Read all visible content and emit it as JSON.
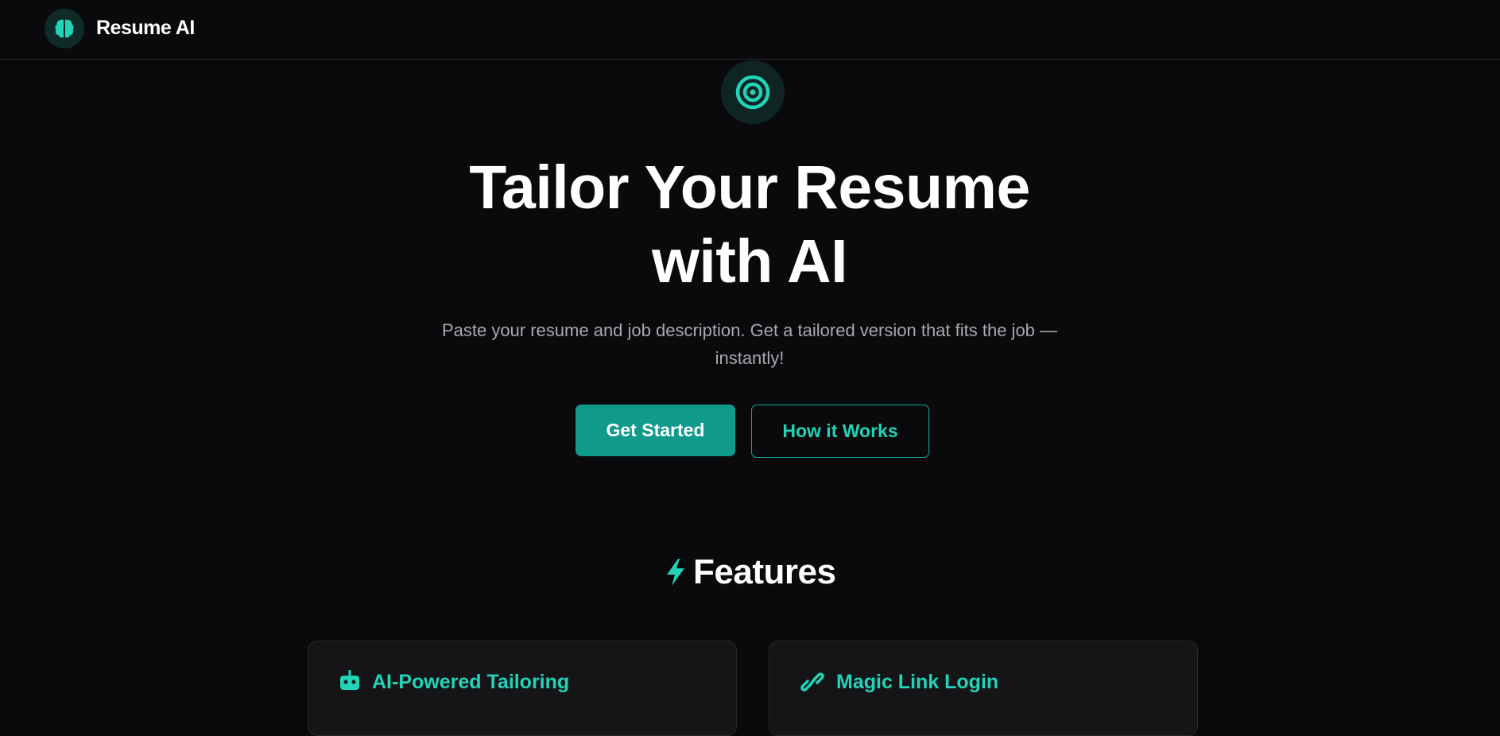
{
  "navbar": {
    "logo_icon": "brain-icon",
    "app_name": "Resume AI"
  },
  "hero": {
    "icon": "target-icon",
    "title_line1": "Tailor Your Resume",
    "title_line2": "with AI",
    "subtitle": "Paste your resume and job description. Get a tailored version that fits the job — instantly!",
    "primary_button_label": "Get Started",
    "secondary_button_label": "How it Works"
  },
  "features": {
    "icon": "lightning-icon",
    "title": "Features",
    "cards": [
      {
        "icon": "robot-icon",
        "title": "AI-Powered Tailoring"
      },
      {
        "icon": "link-icon",
        "title": "Magic Link Login"
      }
    ]
  },
  "colors": {
    "background": "#0a0a0c",
    "accent": "#22d3b7",
    "primary_button": "#0f9a8b",
    "muted_text": "#a7a9ae",
    "card_background": "#151518"
  }
}
